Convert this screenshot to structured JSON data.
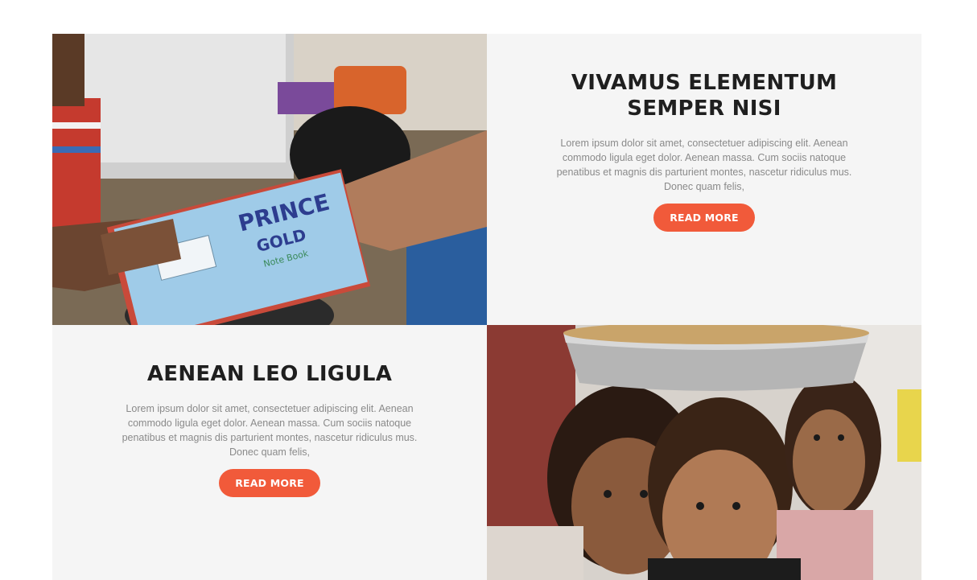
{
  "items": [
    {
      "title": "VIVAMUS ELEMENTUM SEMPER NISI",
      "text": "Lorem ipsum dolor sit amet, consectetuer adipiscing elit. Aenean commodo ligula eget dolor. Aenean massa. Cum sociis natoque penatibus et magnis dis parturient montes, nascetur ridiculus mus. Donec quam felis,",
      "button": "READ MORE"
    },
    {
      "title": "AENEAN LEO LIGULA",
      "text": "Lorem ipsum dolor sit amet, consectetuer adipiscing elit. Aenean commodo ligula eget dolor. Aenean massa. Cum sociis natoque penatibus et magnis dis parturient montes, nascetur ridiculus mus. Donec quam felis,",
      "button": "READ MORE"
    }
  ],
  "photos": {
    "notebook": {
      "brand": "PRINCE",
      "sub": "GOLD",
      "tag": "Note Book"
    }
  },
  "colors": {
    "accent": "#f15a3a",
    "panel_bg": "#f5f5f5",
    "heading": "#1f1f1f",
    "body": "#8a8a8a"
  }
}
